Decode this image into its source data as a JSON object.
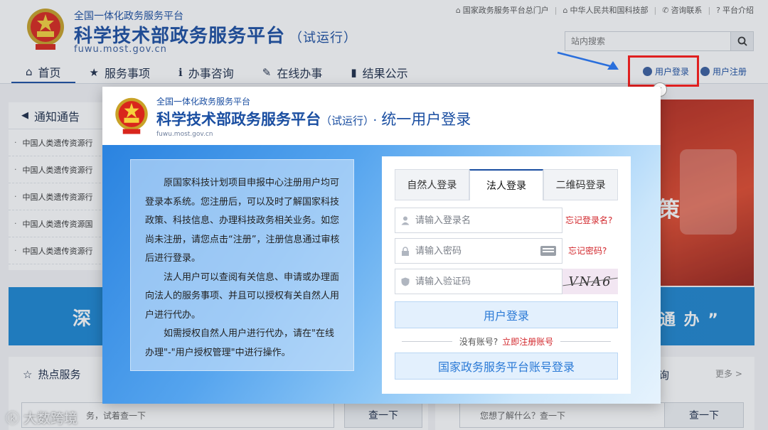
{
  "header": {
    "subtitle": "全国一体化政务服务平台",
    "title": "科学技术部政务服务平台",
    "trial": "（试运行）",
    "domain": "fuwu.most.gov.cn"
  },
  "top_links": [
    {
      "label": "国家政务服务平台总门户",
      "icon": "home-icon"
    },
    {
      "label": "中华人民共和国科技部",
      "icon": "bank-icon"
    },
    {
      "label": "咨询联系",
      "icon": "phone-icon"
    },
    {
      "label": "平台介绍",
      "icon": "help-icon"
    }
  ],
  "search": {
    "placeholder": "站内搜索"
  },
  "nav": [
    {
      "label": "首页",
      "icon": "home-icon",
      "active": true
    },
    {
      "label": "服务事项",
      "icon": "star-icon"
    },
    {
      "label": "办事咨询",
      "icon": "info-icon"
    },
    {
      "label": "在线办事",
      "icon": "pencil-icon"
    },
    {
      "label": "结果公示",
      "icon": "book-icon"
    }
  ],
  "user_links": {
    "login": "用户登录",
    "register": "用户注册"
  },
  "notice": {
    "title": "通知通告",
    "items": [
      "中国人类遗传资源行",
      "中国人类遗传资源行",
      "中国人类遗传资源行",
      "中国人类遗传资源国",
      "中国人类遗传资源行"
    ]
  },
  "banner": {
    "left_text": "深",
    "right_text": "通 办 ”"
  },
  "photo": {
    "text": "策"
  },
  "hot_services": {
    "title": "热点服务",
    "search_text": "务，试着查一下",
    "button": "查一下"
  },
  "right_section": {
    "title_fragment": "询",
    "more": "更多 >",
    "search_text": "您想了解什么？查一下",
    "button": "查一下"
  },
  "watermark": {
    "text": "大数跨境"
  },
  "modal": {
    "subtitle": "全国一体化政务服务平台",
    "title": "科学技术部政务服务平台",
    "trial": "（试运行）",
    "dot": "·",
    "unified": "统一用户登录",
    "domain": "fuwu.most.gov.cn",
    "description": [
      "原国家科技计划项目申报中心注册用户均可登录本系统。您注册后，可以及时了解国家科技政策、科技信息、办理科技政务相关业务。如您尚未注册，请您点击“注册”，注册信息通过审核后进行登录。",
      "法人用户可以查阅有关信息、申请或办理面向法人的服务事项、并且可以授权有关自然人用户进行代办。",
      "如需授权自然人用户进行代办，请在\"在线办理\"-\"用户授权管理\"中进行操作。"
    ],
    "tabs": [
      "自然人登录",
      "法人登录",
      "二维码登录"
    ],
    "active_tab": "法人登录",
    "username_placeholder": "请输入登录名",
    "password_placeholder": "请输入密码",
    "captcha_placeholder": "请输入验证码",
    "forgot_username": "忘记登录名?",
    "forgot_password": "忘记密码?",
    "captcha_text": "VNA6",
    "login_button": "用户登录",
    "no_account": "没有账号?",
    "register_now": "立即注册账号",
    "gov_login_button": "国家政务服务平台账号登录"
  }
}
